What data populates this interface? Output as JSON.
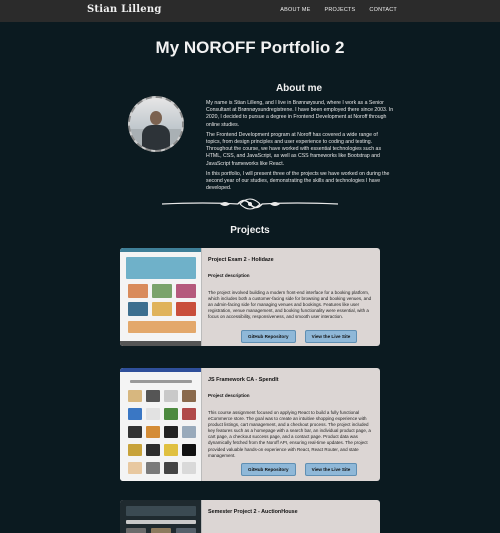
{
  "nav": {
    "brand": "Stian Lilleng",
    "links": [
      "ABOUT ME",
      "PROJECTS",
      "CONTACT"
    ]
  },
  "header": {
    "title": "My NOROFF Portfolio 2"
  },
  "about": {
    "title": "About me",
    "paragraphs": [
      "My name is Stian Lilleng, and I live in Brønnøysund, where I work as a Senior Consultant at Brønnøysundregistrene. I have been employed there since 2003. In 2020, I decided to pursue a degree in Frontend Development at Noroff through online studies.",
      "The Frontend Development program at Noroff has covered a wide range of topics, from design principles and user experience to coding and testing. Throughout the course, we have worked with essential technologies such as HTML, CSS, and JavaScript, as well as CSS frameworks like Bootstrap and JavaScript frameworks like React.",
      "In this portfolio, I will present three of the projects we have worked on during the second year of our studies, demonstrating the skills and technologies I have developed."
    ]
  },
  "projects": {
    "title": "Projects",
    "items": [
      {
        "title": "Project Exam 2 - Holidaze",
        "desc_label": "Project description",
        "description": "The project involved building a modern front-end interface for a booking platform, which includes both a customer-facing side for browsing and booking venues, and an admin-facing side for managing venues and bookings. Features like user registration, venue management, and booking functionality were essential, with a focus on accessibility, responsiveness, and smooth user interaction.",
        "repo_label": "GitHub Repository",
        "live_label": "View the Live Site"
      },
      {
        "title": "JS Framework CA - SpendIt",
        "desc_label": "Project description",
        "description": "This course assignment focused on applying React to build a fully functional eCommerce store. The goal was to create an intuitive shopping experience with product listings, cart management, and a checkout process. The project included key features such as a homepage with a search bar, an individual product page, a cart page, a checkout success page, and a contact page. Product data was dynamically fetched from the Noroff API, ensuring real-time updates. The project provided valuable hands-on experience with React, React Router, and state management.",
        "repo_label": "GitHub Repository",
        "live_label": "View the Live Site"
      },
      {
        "title": "Semester Project 2 - AuctionHouse",
        "desc_label": "",
        "description": "",
        "repo_label": "",
        "live_label": ""
      }
    ]
  },
  "colors": {
    "background": "#0b1a20",
    "navbar": "#2b2b2b",
    "card": "#dcd6d4",
    "button": "#8fb8d8"
  },
  "icons": {
    "avatar": "profile-photo",
    "divider": "ornamental-flourish"
  }
}
